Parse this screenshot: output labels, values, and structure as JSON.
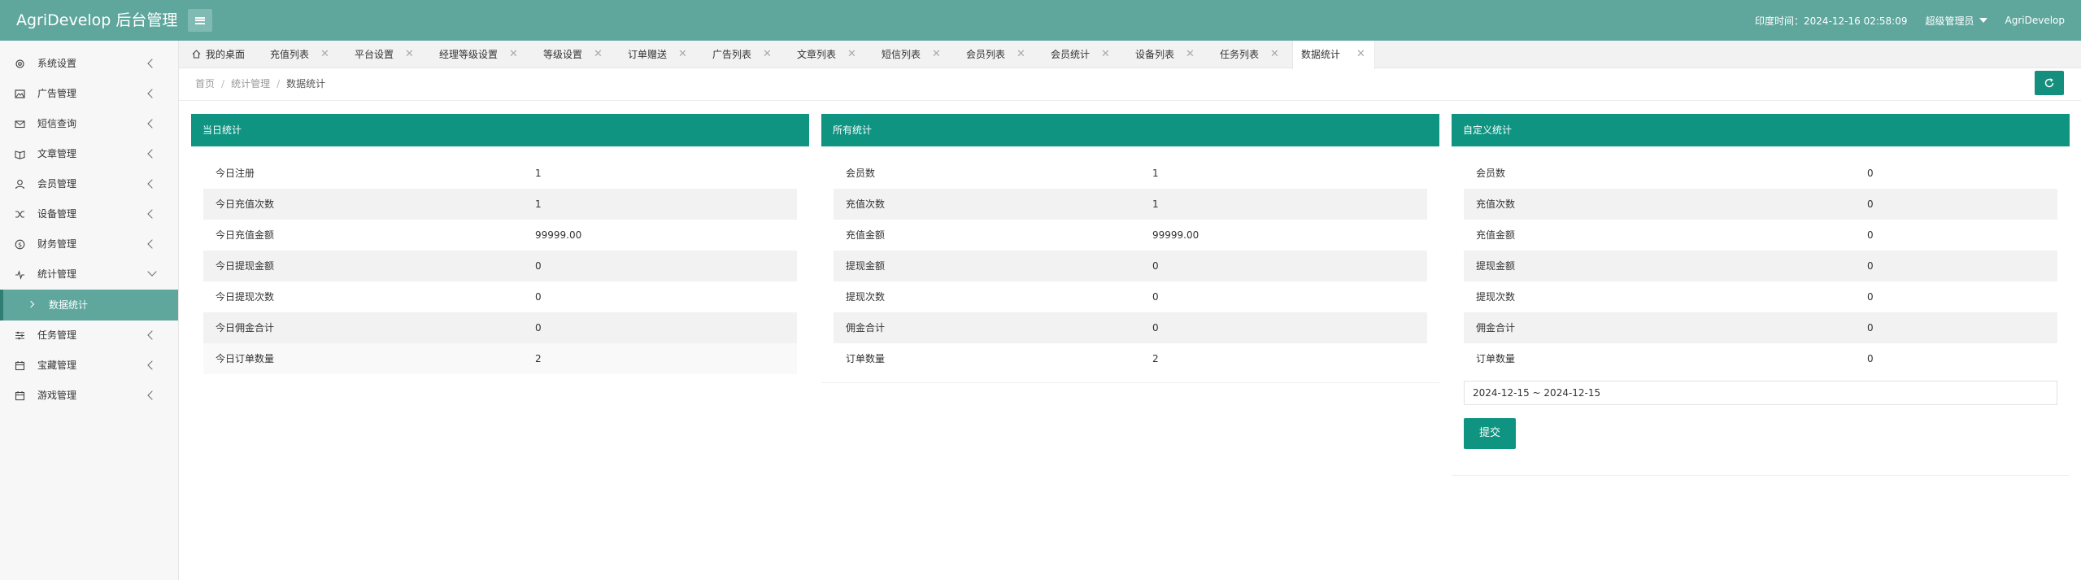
{
  "header": {
    "logo": "AgriDevelop 后台管理",
    "time_text": "印度时间：2024-12-16 02:58:09",
    "admin_menu": "超级管理员",
    "user_name": "AgriDevelop"
  },
  "sidebar": {
    "items": [
      {
        "label": "系统设置",
        "icon": "gear-icon"
      },
      {
        "label": "广告管理",
        "icon": "image-icon"
      },
      {
        "label": "短信查询",
        "icon": "mail-icon"
      },
      {
        "label": "文章管理",
        "icon": "book-icon"
      },
      {
        "label": "会员管理",
        "icon": "user-icon"
      },
      {
        "label": "设备管理",
        "icon": "shuffle-icon"
      },
      {
        "label": "财务管理",
        "icon": "dollar-icon"
      },
      {
        "label": "统计管理",
        "icon": "pulse-icon"
      },
      {
        "label": "任务管理",
        "icon": "sliders-icon"
      },
      {
        "label": "宝藏管理",
        "icon": "calendar-icon"
      },
      {
        "label": "游戏管理",
        "icon": "calendar-icon"
      }
    ],
    "active_sub": "数据统计"
  },
  "tabs": [
    "我的桌面",
    "充值列表",
    "平台设置",
    "经理等级设置",
    "等级设置",
    "订单赠送",
    "广告列表",
    "文章列表",
    "短信列表",
    "会员列表",
    "会员统计",
    "设备列表",
    "任务列表",
    "数据统计"
  ],
  "breadcrumb": [
    "首页",
    "统计管理",
    "数据统计"
  ],
  "today": {
    "title": "当日统计",
    "rows": [
      {
        "k": "今日注册",
        "v": "1"
      },
      {
        "k": "今日充值次数",
        "v": "1"
      },
      {
        "k": "今日充值金额",
        "v": "99999.00"
      },
      {
        "k": "今日提现金额",
        "v": "0"
      },
      {
        "k": "今日提现次数",
        "v": "0"
      },
      {
        "k": "今日佣金合计",
        "v": "0"
      },
      {
        "k": "今日订单数量",
        "v": "2"
      }
    ]
  },
  "all": {
    "title": "所有统计",
    "rows": [
      {
        "k": "会员数",
        "v": "1"
      },
      {
        "k": "充值次数",
        "v": "1"
      },
      {
        "k": "充值金额",
        "v": "99999.00"
      },
      {
        "k": "提现金额",
        "v": "0"
      },
      {
        "k": "提现次数",
        "v": "0"
      },
      {
        "k": "佣金合计",
        "v": "0"
      },
      {
        "k": "订单数量",
        "v": "2"
      }
    ]
  },
  "custom": {
    "title": "自定义统计",
    "rows": [
      {
        "k": "会员数",
        "v": "0"
      },
      {
        "k": "充值次数",
        "v": "0"
      },
      {
        "k": "充值金额",
        "v": "0"
      },
      {
        "k": "提现金额",
        "v": "0"
      },
      {
        "k": "提现次数",
        "v": "0"
      },
      {
        "k": "佣金合计",
        "v": "0"
      },
      {
        "k": "订单数量",
        "v": "0"
      }
    ],
    "date_range": "2024-12-15 ~ 2024-12-15",
    "submit_label": "提交"
  },
  "colors": {
    "header": "#5fa79d",
    "primary": "#0f9482"
  }
}
